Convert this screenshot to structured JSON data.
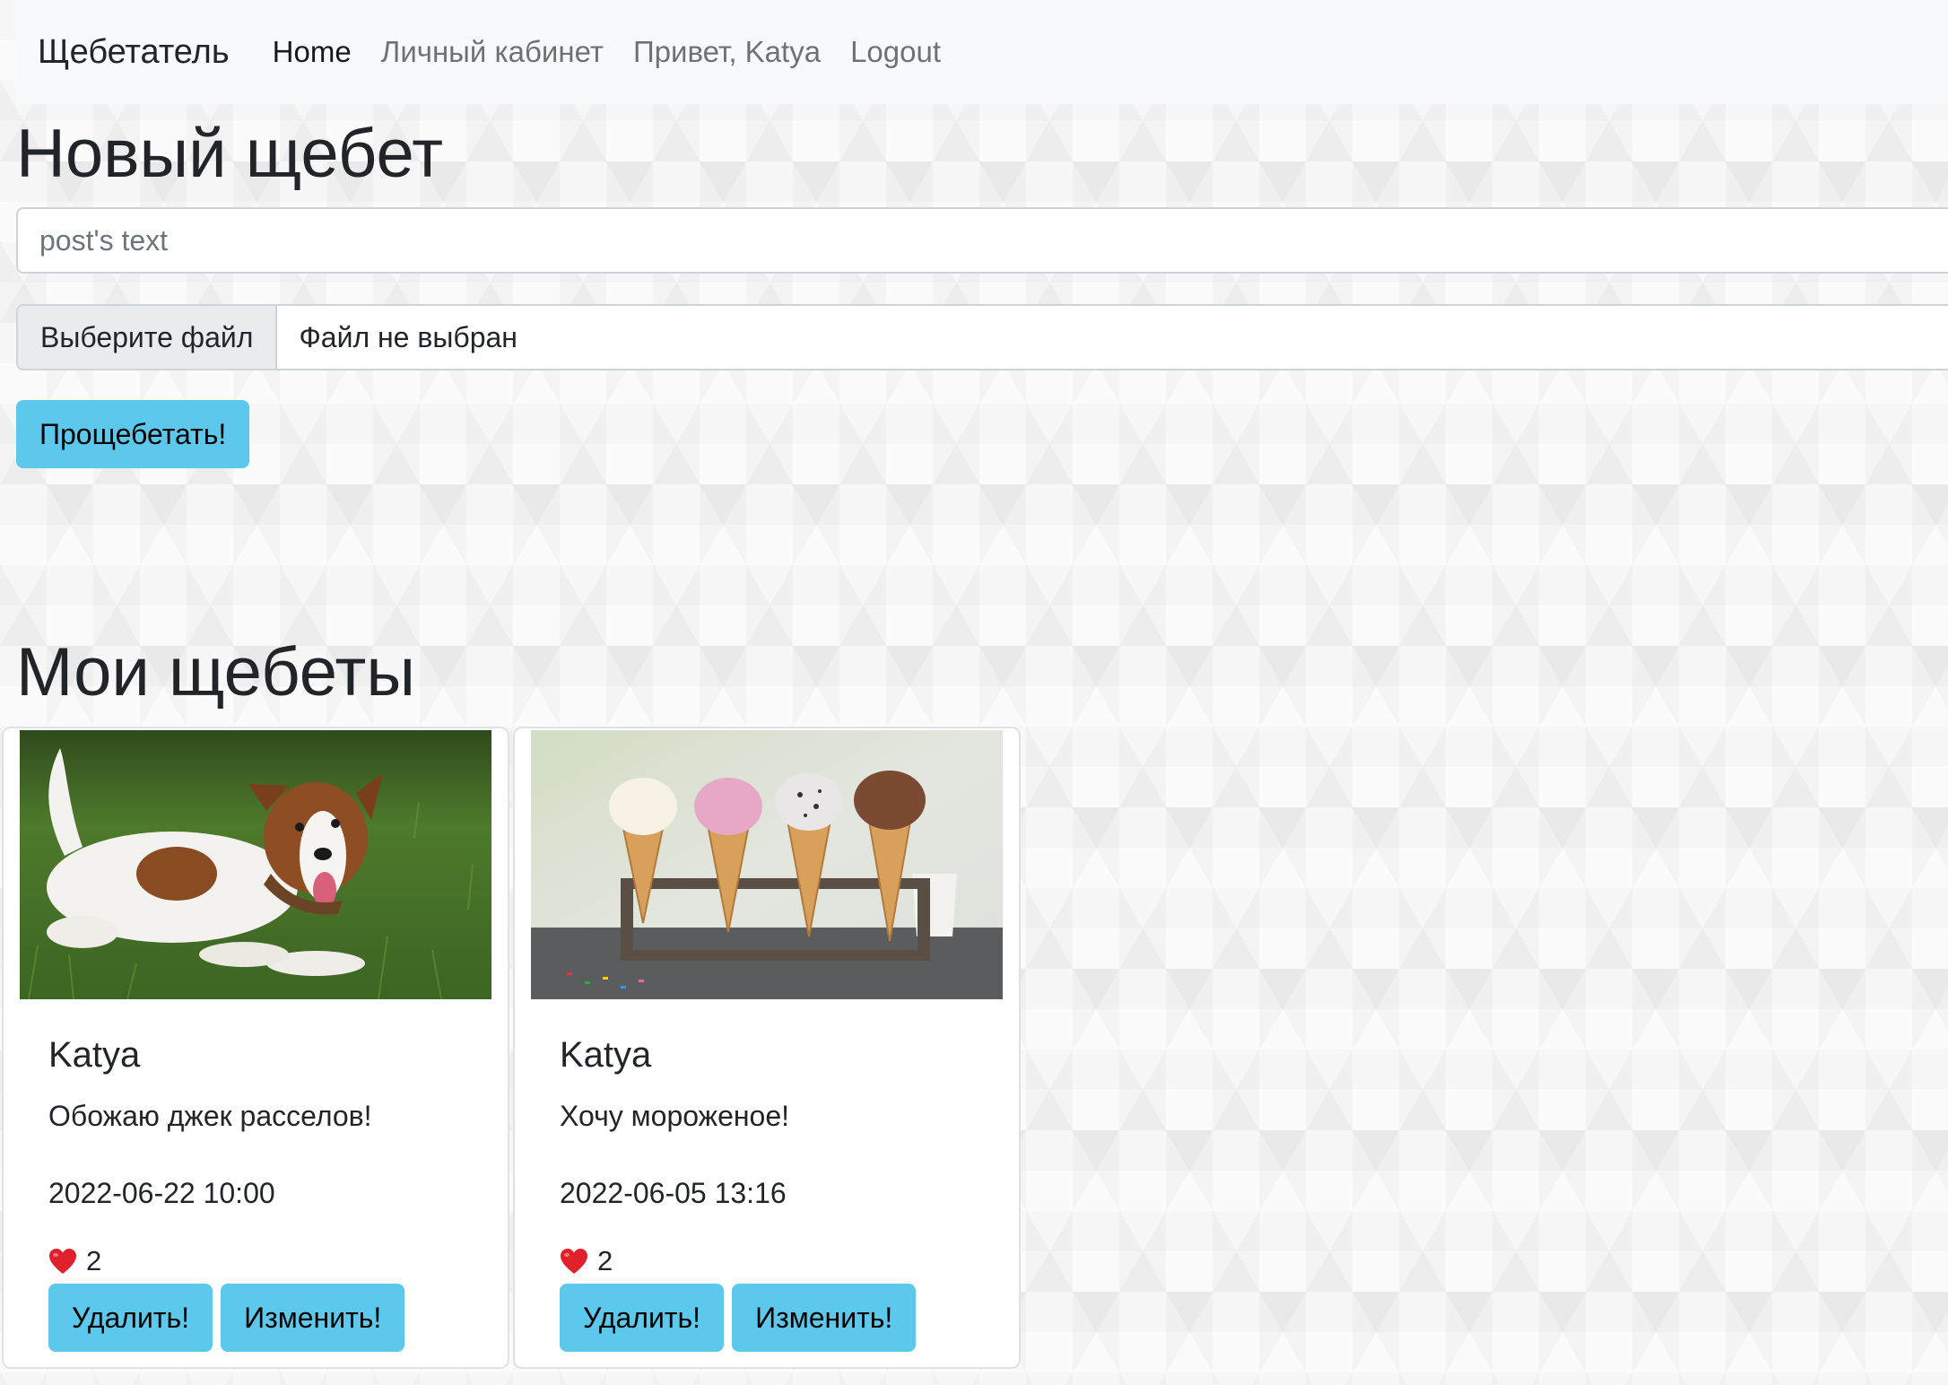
{
  "nav": {
    "brand": "Щебетатель",
    "links": [
      {
        "label": "Home",
        "active": true
      },
      {
        "label": "Личный кабинет",
        "active": false
      },
      {
        "label": "Привет, Katya",
        "active": false
      },
      {
        "label": "Logout",
        "active": false
      }
    ]
  },
  "new_post": {
    "heading": "Новый щебет",
    "text_placeholder": "post's text",
    "file_button": "Выберите файл",
    "file_status": "Файл не выбран",
    "submit_label": "Прощебетать!"
  },
  "my_posts": {
    "heading": "Мои щебеты",
    "posts": [
      {
        "author": "Katya",
        "text": "Обожаю джек расселов!",
        "date": "2022-06-22 10:00",
        "likes": "2",
        "image": "dog-photo",
        "delete_label": "Удалить!",
        "edit_label": "Изменить!"
      },
      {
        "author": "Katya",
        "text": "Хочу мороженое!",
        "date": "2022-06-05 13:16",
        "likes": "2",
        "image": "ice-cream-photo",
        "delete_label": "Удалить!",
        "edit_label": "Изменить!"
      }
    ]
  },
  "colors": {
    "button": "#5bc8ec",
    "navbar": "#f8f9fa",
    "heart": "#e0202a"
  }
}
